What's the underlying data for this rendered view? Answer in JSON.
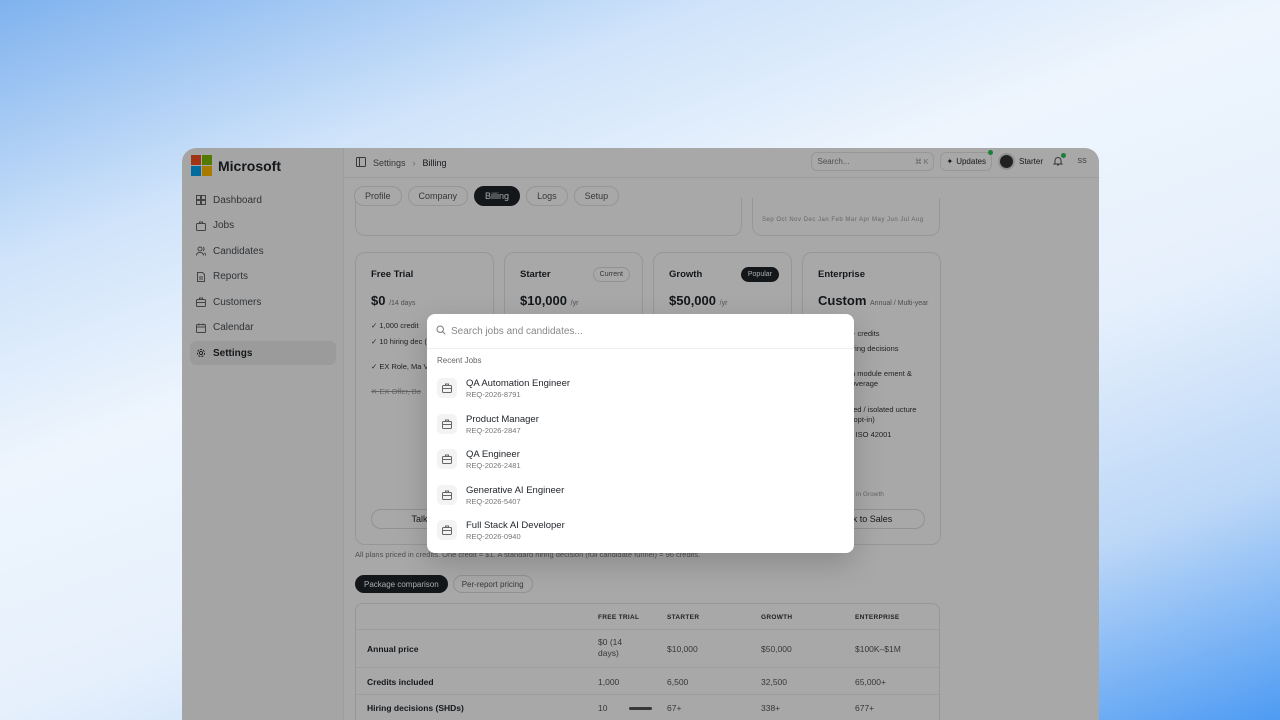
{
  "app": {
    "brand": "Microsoft",
    "logo_colors": [
      "#f25022",
      "#7fba00",
      "#00a4ef",
      "#ffb900"
    ]
  },
  "sidebar": {
    "items": [
      {
        "label": "Dashboard",
        "icon": "dashboard-icon"
      },
      {
        "label": "Jobs",
        "icon": "briefcase-icon"
      },
      {
        "label": "Candidates",
        "icon": "users-icon"
      },
      {
        "label": "Reports",
        "icon": "report-icon"
      },
      {
        "label": "Customers",
        "icon": "customers-icon"
      },
      {
        "label": "Calendar",
        "icon": "calendar-icon"
      },
      {
        "label": "Settings",
        "icon": "gear-icon",
        "active": true
      }
    ]
  },
  "topbar": {
    "breadcrumb": [
      "Settings",
      "Billing"
    ],
    "search_placeholder": "Search...",
    "search_shortcut": "⌘ K",
    "updates_label": "Updates",
    "plan_label": "Starter",
    "initials": "SS"
  },
  "tabs": [
    "Profile",
    "Company",
    "Billing",
    "Logs",
    "Setup"
  ],
  "months_axis": "Sep Oct Nov Dec Jan Feb Mar Apr May Jun Jul Aug",
  "plans": [
    {
      "name": "Free Trial",
      "badge": "",
      "price": "$0",
      "unit": "/14 days",
      "features": [
        "1,000 credit",
        "10 hiring dec (SHDs)",
        "EX Role, Ma Voice, Avata",
        "EX Offer, Bo"
      ],
      "button": "Talk to"
    },
    {
      "name": "Starter",
      "badge": "Current",
      "price": "$10,000",
      "unit": "/yr"
    },
    {
      "name": "Growth",
      "badge": "Popular",
      "price": "$50,000",
      "unit": "/yr"
    },
    {
      "name": "Enterprise",
      "badge": "",
      "price": "Custom",
      "unit": "Annual / Multi-year",
      "features": [
        "+ credits",
        "iring decisions",
        "n module ement & overage",
        "ted / isolated ucture (opt-in)",
        "- ISO 42001",
        "s in Growth"
      ],
      "button": "lk to Sales"
    }
  ],
  "footnote": "All plans priced in credits. One credit = $1. A standard hiring decision (full candidate funnel) = 96 credits.",
  "subtabs": [
    "Package comparison",
    "Per-report pricing"
  ],
  "comparison": {
    "headers": [
      "FREE TRIAL",
      "STARTER",
      "GROWTH",
      "ENTERPRISE"
    ],
    "rows": [
      {
        "label": "Annual price",
        "values": [
          "$0 (14 days)",
          "$10,000",
          "$50,000",
          "$100K–$1M"
        ]
      },
      {
        "label": "Credits included",
        "values": [
          "1,000",
          "6,500",
          "32,500",
          "65,000+"
        ]
      },
      {
        "label": "Hiring decisions (SHDs)",
        "values": [
          "10",
          "67+",
          "338+",
          "677+"
        ]
      }
    ]
  },
  "command_palette": {
    "placeholder": "Search jobs and candidates...",
    "group_title": "Recent Jobs",
    "jobs": [
      {
        "title": "QA Automation Engineer",
        "req": "REQ-2026-8791"
      },
      {
        "title": "Product Manager",
        "req": "REQ-2026-2847"
      },
      {
        "title": "QA Engineer",
        "req": "REQ-2026-2481"
      },
      {
        "title": "Generative AI Engineer",
        "req": "REQ-2026-5407"
      },
      {
        "title": "Full Stack AI Developer",
        "req": "REQ-2026-0940"
      }
    ]
  }
}
